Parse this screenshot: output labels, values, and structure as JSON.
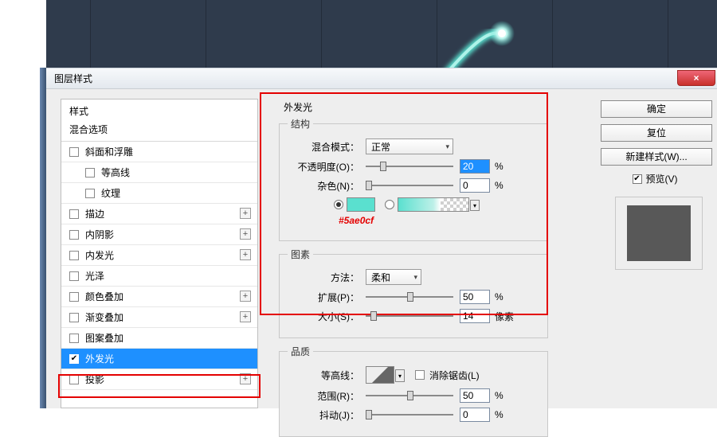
{
  "dialog": {
    "title": "图层样式",
    "close_glyph": "×"
  },
  "styles_panel": {
    "header": "样式",
    "subheader": "混合选项"
  },
  "style_items": [
    {
      "label": "斜面和浮雕",
      "checked": false,
      "indent": false,
      "plus": false
    },
    {
      "label": "等高线",
      "checked": false,
      "indent": true,
      "plus": false
    },
    {
      "label": "纹理",
      "checked": false,
      "indent": true,
      "plus": false
    },
    {
      "label": "描边",
      "checked": false,
      "indent": false,
      "plus": true
    },
    {
      "label": "内阴影",
      "checked": false,
      "indent": false,
      "plus": true
    },
    {
      "label": "内发光",
      "checked": false,
      "indent": false,
      "plus": true
    },
    {
      "label": "光泽",
      "checked": false,
      "indent": false,
      "plus": false
    },
    {
      "label": "颜色叠加",
      "checked": false,
      "indent": false,
      "plus": true
    },
    {
      "label": "渐变叠加",
      "checked": false,
      "indent": false,
      "plus": true
    },
    {
      "label": "图案叠加",
      "checked": false,
      "indent": false,
      "plus": false
    },
    {
      "label": "外发光",
      "checked": true,
      "indent": false,
      "plus": false,
      "selected": true
    },
    {
      "label": "投影",
      "checked": false,
      "indent": false,
      "plus": true
    }
  ],
  "outer_glow": {
    "title": "外发光",
    "structure": {
      "legend": "结构",
      "blend_mode_label": "混合模式：",
      "blend_mode_value": "正常",
      "opacity_label": "不透明度(O)：",
      "opacity_value": "20",
      "opacity_unit": "%",
      "noise_label": "杂色(N)：",
      "noise_value": "0",
      "noise_unit": "%",
      "color_hex_annotation": "#5ae0cf",
      "color_hex": "#5ae0cf"
    },
    "elements": {
      "legend": "图素",
      "technique_label": "方法：",
      "technique_value": "柔和",
      "spread_label": "扩展(P)：",
      "spread_value": "50",
      "spread_unit": "%",
      "size_label": "大小(S)：",
      "size_value": "14",
      "size_unit": "像素"
    },
    "quality": {
      "legend": "品质",
      "contour_label": "等高线：",
      "antialias_label": "消除锯齿(L)",
      "range_label": "范围(R)：",
      "range_value": "50",
      "range_unit": "%",
      "jitter_label": "抖动(J)：",
      "jitter_value": "0",
      "jitter_unit": "%"
    }
  },
  "buttons": {
    "ok": "确定",
    "reset": "复位",
    "new_style": "新建样式(W)...",
    "preview": "预览(V)"
  }
}
